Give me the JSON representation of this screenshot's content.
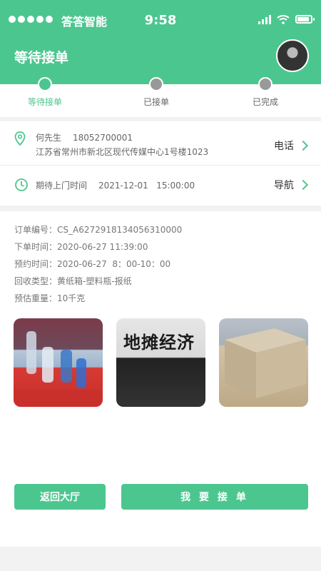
{
  "statusbar": {
    "carrier": "答答智能",
    "time": "9:58"
  },
  "header": {
    "title": "等待接单",
    "avatar_icon": "user-avatar"
  },
  "steps": [
    {
      "label": "等待接单",
      "active": true
    },
    {
      "label": "已接单",
      "active": false
    },
    {
      "label": "已完成",
      "active": false
    }
  ],
  "contact": {
    "name": "何先生",
    "phone": "18052700001",
    "address": "江苏省常州市新北区现代传媒中心1号楼1023",
    "call_label": "电话"
  },
  "visit": {
    "label": "期待上门时间",
    "datetime": "2021-12-01   15:00:00",
    "nav_label": "导航"
  },
  "order": {
    "number": "订单编号：CS_A6272918134056310000",
    "placed": "下单时间：2020-06-27  11:39:00",
    "appointment": "预约时间：2020-06-27  8：00-10：00",
    "types": "回收类型：黄纸箱-塑料瓶-报纸",
    "weight": "预估重量：10千克"
  },
  "photos": {
    "newspaper_headline": "地摊经济"
  },
  "buttons": {
    "back": "返回大厅",
    "accept": "我 要 接 单"
  },
  "colors": {
    "accent": "#4cc68f"
  }
}
